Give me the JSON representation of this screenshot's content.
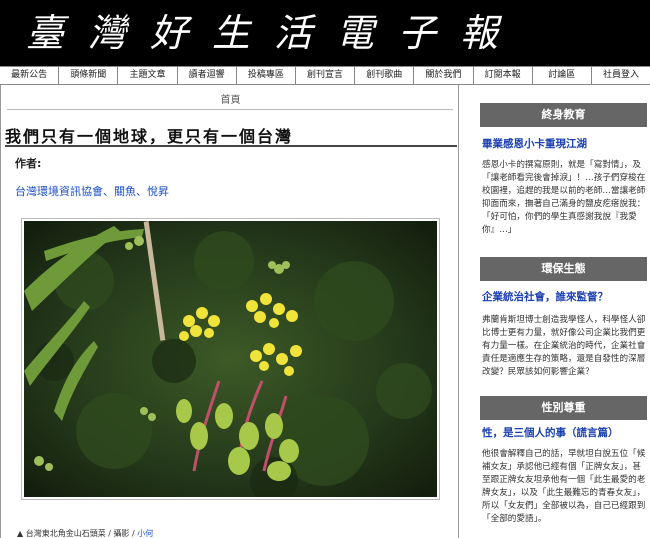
{
  "site": {
    "title": "臺灣好生活電子報"
  },
  "nav": [
    "最新公告",
    "頭條新聞",
    "主題文章",
    "讀者迴響",
    "投稿專區",
    "創刊宣言",
    "創刊歌曲",
    "關於我們",
    "訂閱本報",
    "討論區",
    "社員登入"
  ],
  "article": {
    "breadcrumb": "首頁",
    "title": "我們只有一個地球，更只有一個台灣",
    "author_label": "作者:",
    "source": "台灣環境資訊協會、關魚、悅昇",
    "caption_prefix": "▲ 台灣東北角金山石頭菜 / 攝影 / ",
    "caption_name": "小何"
  },
  "sidebar": [
    {
      "heading": "終身教育",
      "link": "畢業感恩小卡重現江湖",
      "text": "感恩小卡的撰寫原則，就是「寫對情」，及「讓老師看完後會掉淚」！…孩子們穿梭在校園裡，追趕的我是以前的老師…當讓老師抑面而來，撫著自己滿身的鹽皮疙瘩說我：「好可怕，你們的學生真感謝我說『我愛你』…」"
    },
    {
      "heading": "環保生態",
      "link": "企業統治社會，誰來監督？",
      "text": "弗蘭肯斯坦博士創造我學怪人，科學怪人卻比博士更有力量，就好像公司企業比我們更有力量一樣。在企業統治的時代，企業社會責任是適應生存的策略，還是自發性的深層改變？民眾該如何影響企業？"
    },
    {
      "heading": "性別尊重",
      "link": "性，是三個人的事（謊言篇）",
      "text": "他很會解釋自己的話，早就坦白說五位「候補女友」承認他已經有個「正牌女友」，甚至跟正牌女友坦承他有一個「此生最愛的老牌女友」，以及「此生最難忘的青春女友」，所以「女友們」全部被以為，自己已經跟到「全部的愛語」。"
    }
  ],
  "colors": {
    "banner": "#000000",
    "section_heading": "#666666",
    "link": "#1a3fb0"
  }
}
